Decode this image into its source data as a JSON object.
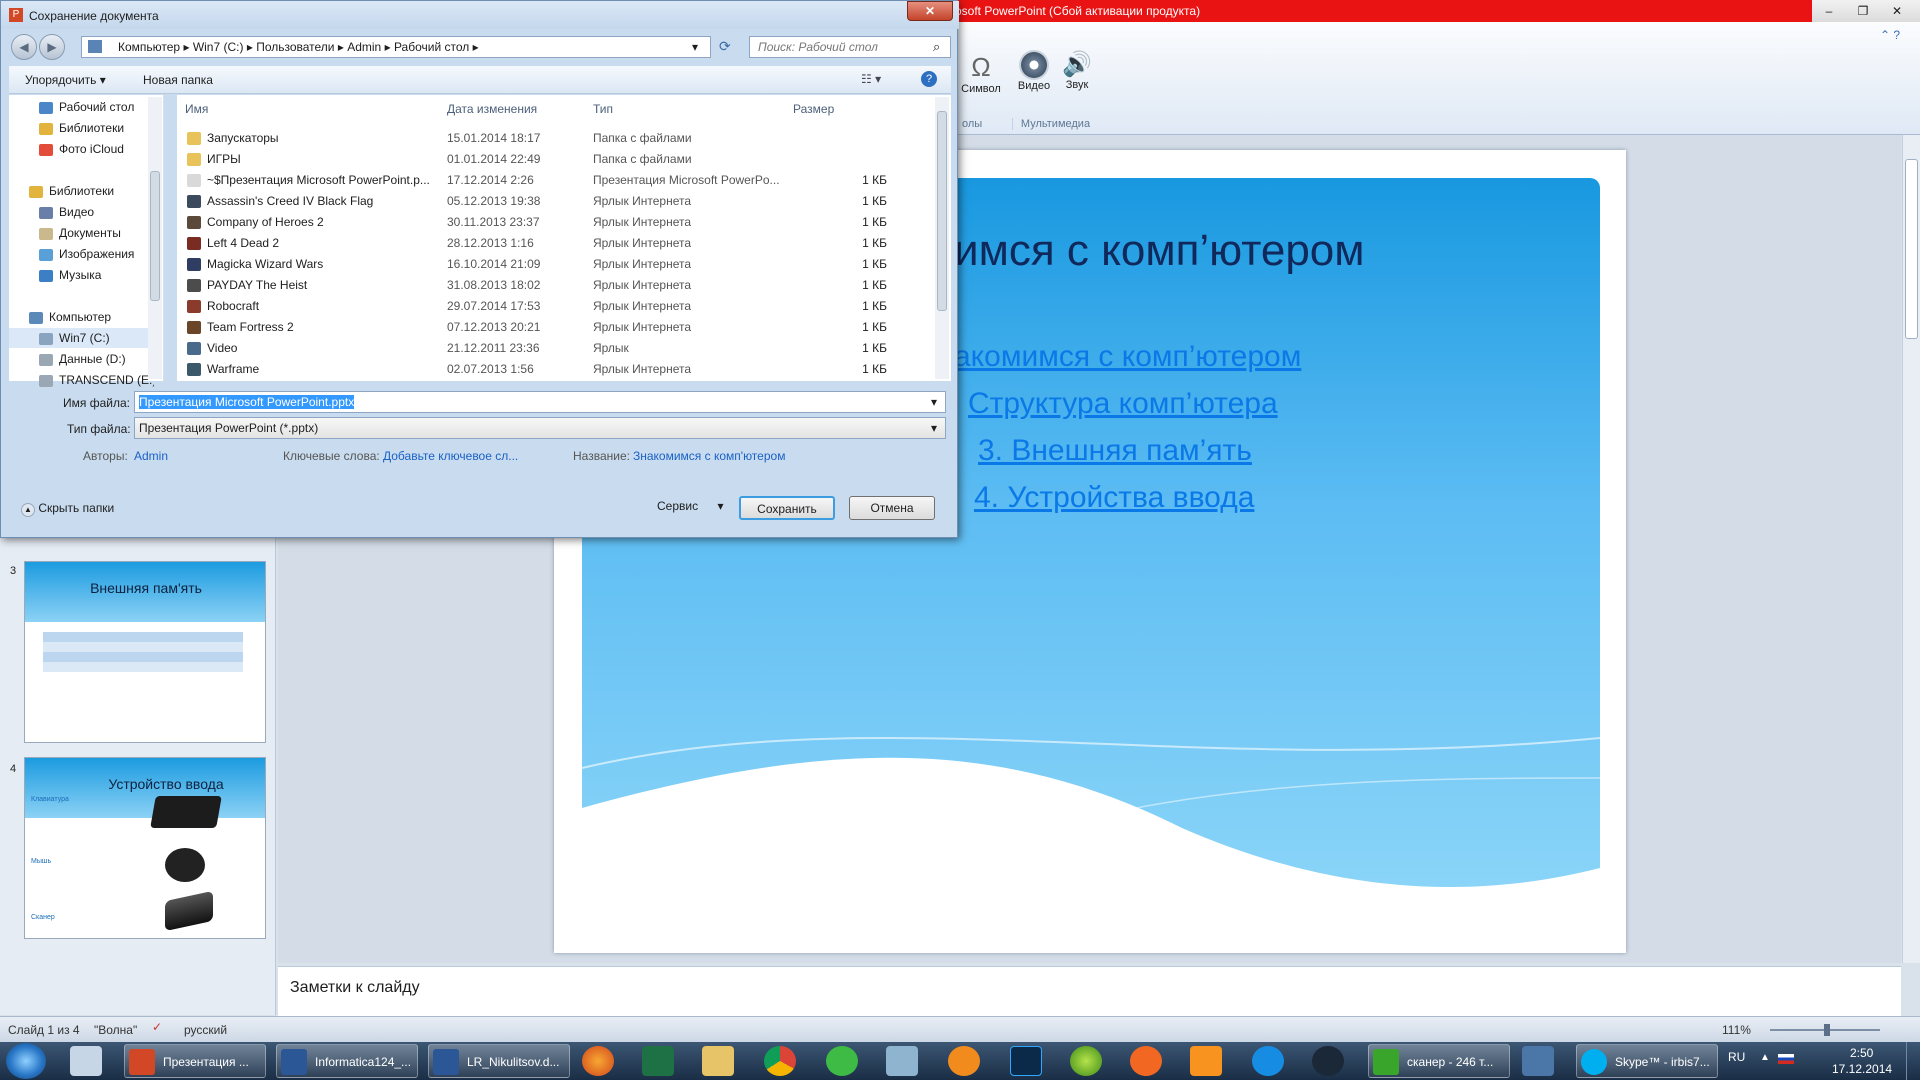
{
  "powerpoint": {
    "title_suffix": "osoft PowerPoint (Сбой активации продукта)",
    "ribbon": {
      "symbol": "Символ",
      "video": "Видео",
      "sound": "Звук",
      "group_symbols": "олы",
      "group_media": "Мультимедиа"
    },
    "slide": {
      "title": "имся с комп’ютером",
      "links": [
        "акомимся с комп’ютером",
        "Структура комп’ютера",
        "3. Внешняя пам’ять",
        "4. Устройства ввода"
      ]
    },
    "thumbnails": [
      {
        "num": "3",
        "title": "Внешняя пам'ять"
      },
      {
        "num": "4",
        "title": "Устройство ввода",
        "bullets": [
          "Клавиатура",
          "Мышь",
          "Сканер"
        ]
      }
    ],
    "notes_placeholder": "Заметки к слайду",
    "status": {
      "slide": "Слайд 1 из 4",
      "theme": "\"Волна\"",
      "lang": "русский",
      "zoom": "111%"
    }
  },
  "dialog": {
    "title": "Сохранение документа",
    "breadcrumb": [
      "Компьютер",
      "Win7 (C:)",
      "Пользователи",
      "Admin",
      "Рабочий стол"
    ],
    "search_placeholder": "Поиск: Рабочий стол",
    "toolbar": {
      "organize": "Упорядочить ▾",
      "new_folder": "Новая папка"
    },
    "nav": [
      {
        "label": "Рабочий стол",
        "color": "#4a86c8"
      },
      {
        "label": "Библиотеки",
        "color": "#e2b33d"
      },
      {
        "label": "Фото iCloud",
        "color": "#e44c3a"
      },
      {
        "label": "",
        "color": ""
      },
      {
        "label": "Библиотеки",
        "color": "#e2b33d"
      },
      {
        "label": "Видео",
        "color": "#6a7fa8"
      },
      {
        "label": "Документы",
        "color": "#c9b98c"
      },
      {
        "label": "Изображения",
        "color": "#5aa0d8"
      },
      {
        "label": "Музыка",
        "color": "#3d7fc4"
      },
      {
        "label": "",
        "color": ""
      },
      {
        "label": "Компьютер",
        "color": "#5c8ab8"
      },
      {
        "label": "Win7 (C:)",
        "color": "#8aa4c0"
      },
      {
        "label": "Данные (D:)",
        "color": "#9aa7b4"
      },
      {
        "label": "TRANSCEND (E:)",
        "color": "#9aa7b4"
      }
    ],
    "columns": [
      "Имя",
      "Дата изменения",
      "Тип",
      "Размер"
    ],
    "files": [
      {
        "name": "Запускаторы",
        "date": "15.01.2014 18:17",
        "type": "Папка с файлами",
        "size": "",
        "color": "#e8c35a"
      },
      {
        "name": "ИГРЫ",
        "date": "01.01.2014 22:49",
        "type": "Папка с файлами",
        "size": "",
        "color": "#e8c35a"
      },
      {
        "name": "~$Презентация Microsoft PowerPoint.p...",
        "date": "17.12.2014 2:26",
        "type": "Презентация Microsoft PowerPo...",
        "size": "1 КБ",
        "color": "#d9d9d9"
      },
      {
        "name": "Assassin's Creed IV Black Flag",
        "date": "05.12.2013 19:38",
        "type": "Ярлык Интернета",
        "size": "1 КБ",
        "color": "#3b4a5c"
      },
      {
        "name": "Company of Heroes 2",
        "date": "30.11.2013 23:37",
        "type": "Ярлык Интернета",
        "size": "1 КБ",
        "color": "#5b4a3a"
      },
      {
        "name": "Left 4 Dead 2",
        "date": "28.12.2013 1:16",
        "type": "Ярлык Интернета",
        "size": "1 КБ",
        "color": "#7a2b22"
      },
      {
        "name": "Magicka Wizard Wars",
        "date": "16.10.2014 21:09",
        "type": "Ярлык Интернета",
        "size": "1 КБ",
        "color": "#2f3d63"
      },
      {
        "name": "PAYDAY The Heist",
        "date": "31.08.2013 18:02",
        "type": "Ярлык Интернета",
        "size": "1 КБ",
        "color": "#4c4c4c"
      },
      {
        "name": "Robocraft",
        "date": "29.07.2014 17:53",
        "type": "Ярлык Интернета",
        "size": "1 КБ",
        "color": "#8a3b2b"
      },
      {
        "name": "Team Fortress 2",
        "date": "07.12.2013 20:21",
        "type": "Ярлык Интернета",
        "size": "1 КБ",
        "color": "#6b4528"
      },
      {
        "name": "Video",
        "date": "21.12.2011 23:36",
        "type": "Ярлык",
        "size": "1 КБ",
        "color": "#4a6a8c"
      },
      {
        "name": "Warframe",
        "date": "02.07.2013 1:56",
        "type": "Ярлык Интернета",
        "size": "1 КБ",
        "color": "#3a5a6a"
      }
    ],
    "filename_label": "Имя файла:",
    "filename_value": "Презентация Microsoft PowerPoint.pptx",
    "filetype_label": "Тип файла:",
    "filetype_value": "Презентация PowerPoint (*.pptx)",
    "authors_label": "Авторы:",
    "authors_value": "Admin",
    "keywords_label": "Ключевые слова:",
    "keywords_value": "Добавьте ключевое сл...",
    "name_label": "Название:",
    "name_value": "Знакомимся с комп'ютером",
    "hide_folders": "Скрыть папки",
    "service": "Сервис",
    "save": "Сохранить",
    "cancel": "Отмена"
  },
  "taskbar": {
    "items": [
      {
        "label": "Презентация ...",
        "color": "#d24726"
      },
      {
        "label": "Informatica124_...",
        "color": "#2b5797"
      },
      {
        "label": "LR_Nikulitsov.d...",
        "color": "#2b5797"
      },
      {
        "label": "сканер - 246 т...",
        "color": "#3aa52b"
      },
      {
        "label": "Skype™ - irbis7...",
        "color": "#00aff0"
      }
    ],
    "lang": "RU",
    "time": "2:50",
    "date": "17.12.2014"
  }
}
